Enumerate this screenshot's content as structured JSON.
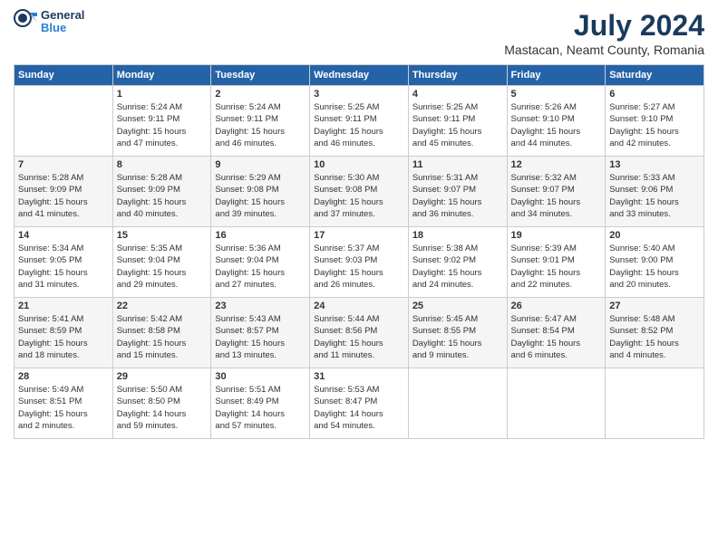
{
  "header": {
    "logo_line1": "General",
    "logo_line2": "Blue",
    "main_title": "July 2024",
    "subtitle": "Mastacan, Neamt County, Romania"
  },
  "days_of_week": [
    "Sunday",
    "Monday",
    "Tuesday",
    "Wednesday",
    "Thursday",
    "Friday",
    "Saturday"
  ],
  "weeks": [
    [
      {
        "day": "",
        "info": ""
      },
      {
        "day": "1",
        "info": "Sunrise: 5:24 AM\nSunset: 9:11 PM\nDaylight: 15 hours\nand 47 minutes."
      },
      {
        "day": "2",
        "info": "Sunrise: 5:24 AM\nSunset: 9:11 PM\nDaylight: 15 hours\nand 46 minutes."
      },
      {
        "day": "3",
        "info": "Sunrise: 5:25 AM\nSunset: 9:11 PM\nDaylight: 15 hours\nand 46 minutes."
      },
      {
        "day": "4",
        "info": "Sunrise: 5:25 AM\nSunset: 9:11 PM\nDaylight: 15 hours\nand 45 minutes."
      },
      {
        "day": "5",
        "info": "Sunrise: 5:26 AM\nSunset: 9:10 PM\nDaylight: 15 hours\nand 44 minutes."
      },
      {
        "day": "6",
        "info": "Sunrise: 5:27 AM\nSunset: 9:10 PM\nDaylight: 15 hours\nand 42 minutes."
      }
    ],
    [
      {
        "day": "7",
        "info": "Sunrise: 5:28 AM\nSunset: 9:09 PM\nDaylight: 15 hours\nand 41 minutes."
      },
      {
        "day": "8",
        "info": "Sunrise: 5:28 AM\nSunset: 9:09 PM\nDaylight: 15 hours\nand 40 minutes."
      },
      {
        "day": "9",
        "info": "Sunrise: 5:29 AM\nSunset: 9:08 PM\nDaylight: 15 hours\nand 39 minutes."
      },
      {
        "day": "10",
        "info": "Sunrise: 5:30 AM\nSunset: 9:08 PM\nDaylight: 15 hours\nand 37 minutes."
      },
      {
        "day": "11",
        "info": "Sunrise: 5:31 AM\nSunset: 9:07 PM\nDaylight: 15 hours\nand 36 minutes."
      },
      {
        "day": "12",
        "info": "Sunrise: 5:32 AM\nSunset: 9:07 PM\nDaylight: 15 hours\nand 34 minutes."
      },
      {
        "day": "13",
        "info": "Sunrise: 5:33 AM\nSunset: 9:06 PM\nDaylight: 15 hours\nand 33 minutes."
      }
    ],
    [
      {
        "day": "14",
        "info": "Sunrise: 5:34 AM\nSunset: 9:05 PM\nDaylight: 15 hours\nand 31 minutes."
      },
      {
        "day": "15",
        "info": "Sunrise: 5:35 AM\nSunset: 9:04 PM\nDaylight: 15 hours\nand 29 minutes."
      },
      {
        "day": "16",
        "info": "Sunrise: 5:36 AM\nSunset: 9:04 PM\nDaylight: 15 hours\nand 27 minutes."
      },
      {
        "day": "17",
        "info": "Sunrise: 5:37 AM\nSunset: 9:03 PM\nDaylight: 15 hours\nand 26 minutes."
      },
      {
        "day": "18",
        "info": "Sunrise: 5:38 AM\nSunset: 9:02 PM\nDaylight: 15 hours\nand 24 minutes."
      },
      {
        "day": "19",
        "info": "Sunrise: 5:39 AM\nSunset: 9:01 PM\nDaylight: 15 hours\nand 22 minutes."
      },
      {
        "day": "20",
        "info": "Sunrise: 5:40 AM\nSunset: 9:00 PM\nDaylight: 15 hours\nand 20 minutes."
      }
    ],
    [
      {
        "day": "21",
        "info": "Sunrise: 5:41 AM\nSunset: 8:59 PM\nDaylight: 15 hours\nand 18 minutes."
      },
      {
        "day": "22",
        "info": "Sunrise: 5:42 AM\nSunset: 8:58 PM\nDaylight: 15 hours\nand 15 minutes."
      },
      {
        "day": "23",
        "info": "Sunrise: 5:43 AM\nSunset: 8:57 PM\nDaylight: 15 hours\nand 13 minutes."
      },
      {
        "day": "24",
        "info": "Sunrise: 5:44 AM\nSunset: 8:56 PM\nDaylight: 15 hours\nand 11 minutes."
      },
      {
        "day": "25",
        "info": "Sunrise: 5:45 AM\nSunset: 8:55 PM\nDaylight: 15 hours\nand 9 minutes."
      },
      {
        "day": "26",
        "info": "Sunrise: 5:47 AM\nSunset: 8:54 PM\nDaylight: 15 hours\nand 6 minutes."
      },
      {
        "day": "27",
        "info": "Sunrise: 5:48 AM\nSunset: 8:52 PM\nDaylight: 15 hours\nand 4 minutes."
      }
    ],
    [
      {
        "day": "28",
        "info": "Sunrise: 5:49 AM\nSunset: 8:51 PM\nDaylight: 15 hours\nand 2 minutes."
      },
      {
        "day": "29",
        "info": "Sunrise: 5:50 AM\nSunset: 8:50 PM\nDaylight: 14 hours\nand 59 minutes."
      },
      {
        "day": "30",
        "info": "Sunrise: 5:51 AM\nSunset: 8:49 PM\nDaylight: 14 hours\nand 57 minutes."
      },
      {
        "day": "31",
        "info": "Sunrise: 5:53 AM\nSunset: 8:47 PM\nDaylight: 14 hours\nand 54 minutes."
      },
      {
        "day": "",
        "info": ""
      },
      {
        "day": "",
        "info": ""
      },
      {
        "day": "",
        "info": ""
      }
    ]
  ]
}
